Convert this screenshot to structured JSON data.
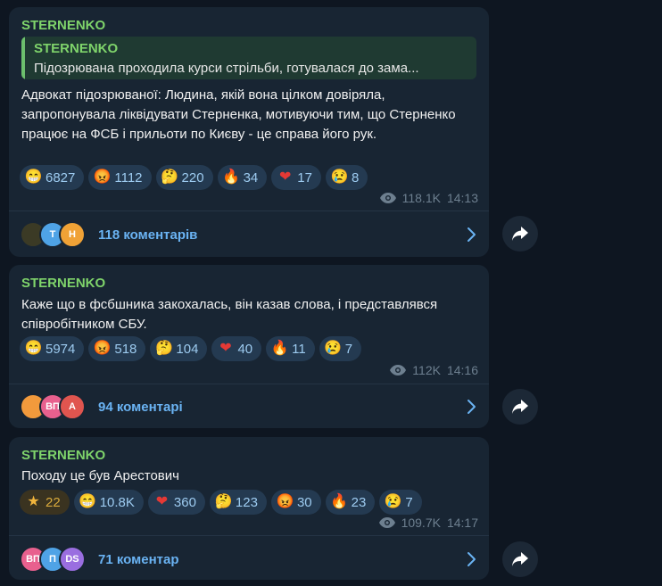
{
  "posts": [
    {
      "author": "STERNENKO",
      "reply": {
        "author": "STERNENKO",
        "text": "Підозрювана проходила курси стрільби, готувалася до зама..."
      },
      "text": "Адвокат підозрюваної: Людина, якій вона цілком довіряла, запропонувала ліквідувати Стерненка, мотивуючи тим, що Стерненко працює на ФСБ і прильоти по Києву - це справа його рук.",
      "reactions": [
        {
          "icon": "grinning-face-icon",
          "count": "6827"
        },
        {
          "icon": "angry-face-icon",
          "count": "1112"
        },
        {
          "icon": "thinking-face-icon",
          "count": "220"
        },
        {
          "icon": "fire-icon",
          "count": "34"
        },
        {
          "icon": "red-heart-icon",
          "count": "17"
        },
        {
          "icon": "crying-face-icon",
          "count": "8"
        }
      ],
      "views": "118.1K",
      "time": "14:13",
      "comments": {
        "label": "118 коментарів",
        "avatars": [
          {
            "text": "",
            "color": "#3b3a25"
          },
          {
            "text": "Т",
            "color": "#4fa3e6"
          },
          {
            "text": "Н",
            "color": "#f0a236"
          }
        ]
      }
    },
    {
      "author": "STERNENKO",
      "text": "Каже що в фсбшника закохалась, він казав слова, і представлявся співробітником СБУ.",
      "reactions": [
        {
          "icon": "grinning-face-icon",
          "count": "5974"
        },
        {
          "icon": "angry-face-icon",
          "count": "518"
        },
        {
          "icon": "thinking-face-icon",
          "count": "104"
        },
        {
          "icon": "red-heart-icon",
          "count": "40"
        },
        {
          "icon": "fire-icon",
          "count": "11"
        },
        {
          "icon": "crying-face-icon",
          "count": "7"
        }
      ],
      "views": "112K",
      "time": "14:16",
      "comments": {
        "label": "94 коментарі",
        "avatars": [
          {
            "text": "",
            "color": "#f29a3c"
          },
          {
            "text": "ВП",
            "color": "#e8608e"
          },
          {
            "text": "А",
            "color": "#e0554f"
          }
        ]
      }
    },
    {
      "author": "STERNENKO",
      "text": "Походу це був Арестович",
      "reactions": [
        {
          "icon": "star-icon",
          "count": "22",
          "paid": true
        },
        {
          "icon": "grinning-face-icon",
          "count": "10.8K"
        },
        {
          "icon": "red-heart-icon",
          "count": "360"
        },
        {
          "icon": "thinking-face-icon",
          "count": "123"
        },
        {
          "icon": "angry-face-icon",
          "count": "30"
        },
        {
          "icon": "fire-icon",
          "count": "23"
        },
        {
          "icon": "crying-face-icon",
          "count": "7"
        }
      ],
      "views": "109.7K",
      "time": "14:17",
      "comments": {
        "label": "71 коментар",
        "avatars": [
          {
            "text": "ВП",
            "color": "#e8608e"
          },
          {
            "text": "П",
            "color": "#4fa3e6"
          },
          {
            "text": "DS",
            "color": "#9a6ee0"
          }
        ]
      }
    }
  ],
  "emoji_glyphs": {
    "grinning-face-icon": "😁",
    "angry-face-icon": "😡",
    "thinking-face-icon": "🤔",
    "fire-icon": "🔥",
    "red-heart-icon": "❤",
    "crying-face-icon": "😢",
    "star-icon": "★"
  }
}
